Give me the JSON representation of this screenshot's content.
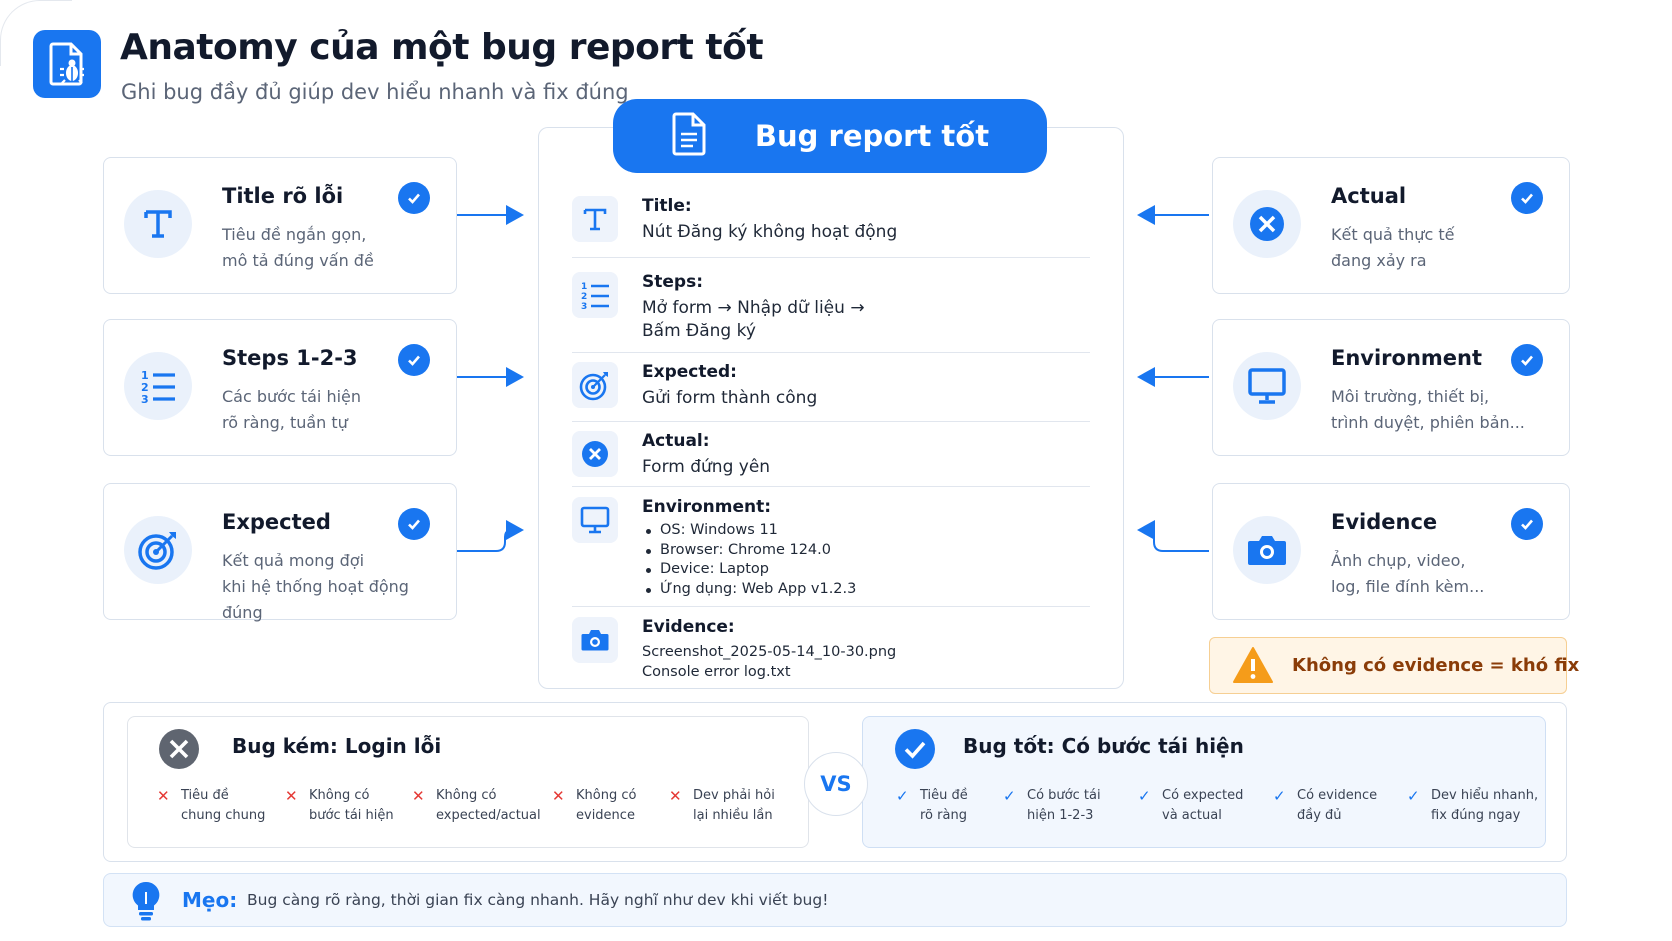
{
  "header": {
    "title": "Anatomy của một bug report tốt",
    "subtitle": "Ghi bug đầy đủ giúp dev hiểu nhanh và fix đúng",
    "icon": "bug-document-icon"
  },
  "center": {
    "banner_title": "Bug report tốt",
    "fields": [
      {
        "label": "Title:",
        "value": "Nút Đăng ký không hoạt động",
        "icon": "text-t-icon"
      },
      {
        "label": "Steps:",
        "lines": [
          "Mở form → Nhập dữ liệu →",
          "Bấm Đăng ký"
        ],
        "icon": "numbered-list-icon"
      },
      {
        "label": "Expected:",
        "value": "Gửi form thành công",
        "icon": "target-icon"
      },
      {
        "label": "Actual:",
        "value": "Form đứng yên",
        "icon": "x-circle-icon"
      },
      {
        "label": "Environment:",
        "items": [
          "OS: Windows 11",
          "Browser: Chrome 124.0",
          "Device: Laptop",
          "Ứng dụng: Web App v1.2.3"
        ],
        "icon": "monitor-icon"
      },
      {
        "label": "Evidence:",
        "lines": [
          "Screenshot_2025-05-14_10-30.png",
          "Console error log.txt"
        ],
        "icon": "camera-icon"
      }
    ]
  },
  "left_cards": [
    {
      "title": "Title rõ lỗi",
      "desc": [
        "Tiêu đề ngắn gọn,",
        "mô tả đúng vấn đề"
      ],
      "icon": "text-t-icon"
    },
    {
      "title": "Steps 1-2-3",
      "desc": [
        "Các bước tái hiện",
        "rõ ràng, tuần tự"
      ],
      "icon": "numbered-list-icon"
    },
    {
      "title": "Expected",
      "desc": [
        "Kết quả mong đợi",
        "khi hệ thống hoạt động đúng"
      ],
      "icon": "target-icon"
    }
  ],
  "right_cards": [
    {
      "title": "Actual",
      "desc": [
        "Kết quả thực tế",
        "đang xảy ra"
      ],
      "icon": "x-circle-icon"
    },
    {
      "title": "Environment",
      "desc": [
        "Môi trường, thiết bị,",
        "trình duyệt, phiên bản..."
      ],
      "icon": "monitor-icon"
    },
    {
      "title": "Evidence",
      "desc": [
        "Ảnh chụp, video,",
        "log, file đính kèm..."
      ],
      "icon": "camera-icon"
    }
  ],
  "warning": {
    "text": "Không có evidence = khó fix",
    "icon": "warning-triangle-icon"
  },
  "comparison": {
    "bad": {
      "title": "Bug kém: Login lỗi",
      "items": [
        [
          "Tiêu đề",
          "chung chung"
        ],
        [
          "Không có",
          "bước tái hiện"
        ],
        [
          "Không có",
          "expected/actual"
        ],
        [
          "Không có",
          "evidence"
        ],
        [
          "Dev phải hỏi",
          "lại nhiều lần"
        ]
      ]
    },
    "vs": "VS",
    "good": {
      "title": "Bug tốt: Có bước tái hiện",
      "items": [
        [
          "Tiêu đề",
          "rõ ràng"
        ],
        [
          "Có bước tái",
          "hiện 1-2-3"
        ],
        [
          "Có expected",
          "và actual"
        ],
        [
          "Có evidence",
          "đầy đủ"
        ],
        [
          "Dev hiểu nhanh,",
          "fix đúng ngay"
        ]
      ]
    }
  },
  "tip": {
    "label": "Mẹo:",
    "text": "Bug càng rõ ràng, thời gian fix càng nhanh. Hãy nghĩ như dev khi viết bug!",
    "icon": "lightbulb-icon"
  },
  "colors": {
    "accent": "#1976f0",
    "warning_text": "#8a3c08",
    "warning_bg": "#fff5e6",
    "bad": "#e53935"
  }
}
